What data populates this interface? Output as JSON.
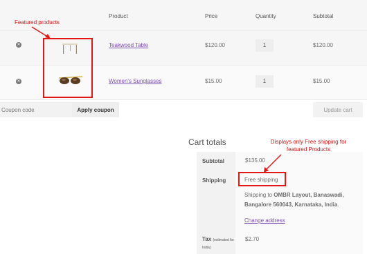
{
  "cart": {
    "headers": {
      "product": "Product",
      "price": "Price",
      "quantity": "Quantity",
      "subtotal": "Subtotal"
    },
    "items": [
      {
        "remove_icon": "remove-circle-icon",
        "thumbnail": "teakwood-table-thumbnail",
        "name": "Teakwood Table",
        "price": "$120.00",
        "quantity": "1",
        "subtotal": "$120.00"
      },
      {
        "remove_icon": "remove-circle-icon",
        "thumbnail": "sunglasses-thumbnail",
        "name": "Women's Sunglasses",
        "price": "$15.00",
        "quantity": "1",
        "subtotal": "$15.00"
      }
    ],
    "coupon_placeholder": "Coupon code",
    "apply_coupon_label": "Apply coupon",
    "update_cart_label": "Update cart"
  },
  "totals": {
    "title": "Cart totals",
    "subtotal_label": "Subtotal",
    "subtotal_value": "$135.00",
    "shipping_label": "Shipping",
    "shipping_method": "Free shipping",
    "shipping_to_prefix": "Shipping to",
    "shipping_address": "OMBR Layout, Banaswadi, Bangalore 560043, Karnataka, India",
    "change_address_label": "Change address",
    "tax_label": "Tax",
    "tax_note": "(estimated for India)",
    "tax_value": "$2.70"
  },
  "annotations": {
    "featured": "Featured products",
    "shipping_note": "Displays only Free shipping for featured Products",
    "color": "#e51616"
  },
  "colors": {
    "link": "#7b4fb0",
    "table_bg": "#f7f6f7"
  }
}
